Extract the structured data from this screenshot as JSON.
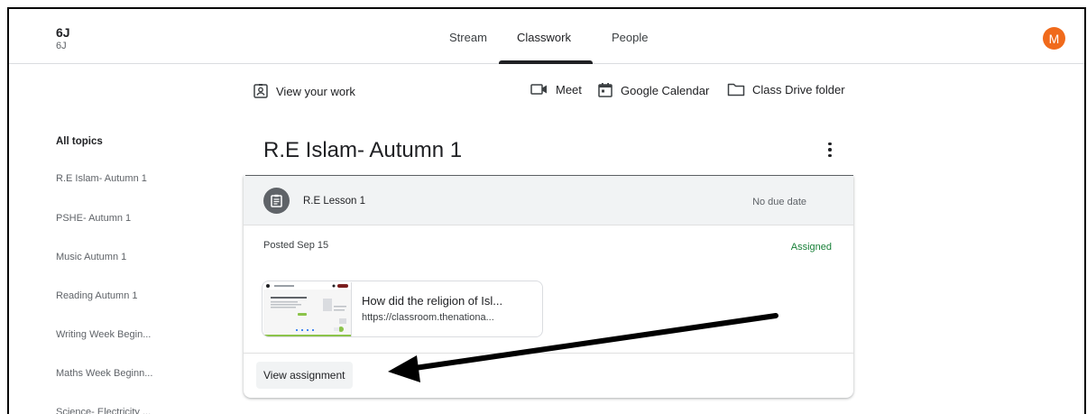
{
  "header": {
    "class_name": "6J",
    "class_section": "6J",
    "tabs": [
      "Stream",
      "Classwork",
      "People"
    ],
    "active_tab": "Classwork",
    "avatar_letter": "M",
    "avatar_color": "#f06a1b"
  },
  "toolbar": {
    "view_work": "View your work",
    "meet": "Meet",
    "calendar": "Google Calendar",
    "drive": "Class Drive folder"
  },
  "sidebar": {
    "all_topics": "All topics",
    "items": [
      "R.E Islam- Autumn 1",
      "PSHE- Autumn 1",
      "Music Autumn 1",
      "Reading Autumn 1",
      "Writing Week Begin...",
      "Maths Week Beginn...",
      "Science- Electricity ..."
    ]
  },
  "topic": {
    "title": "R.E Islam- Autumn 1"
  },
  "assignment": {
    "title": "R.E Lesson 1",
    "due": "No due date",
    "posted": "Posted Sep 15",
    "status": "Assigned",
    "status_color": "#188038",
    "attachment_title": "How did the religion of Isl...",
    "attachment_url": "https://classroom.thenationa...",
    "view_button": "View assignment"
  }
}
